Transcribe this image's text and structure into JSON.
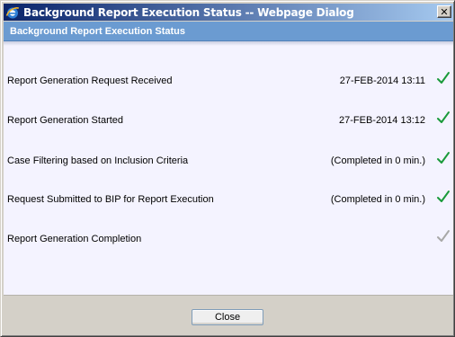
{
  "window": {
    "title": "Background Report Execution Status -- Webpage Dialog",
    "close_glyph": "✕"
  },
  "header": {
    "title": "Background Report Execution Status"
  },
  "steps": [
    {
      "label": "Report Generation Request Received",
      "value": "27-FEB-2014 13:11",
      "status": "complete",
      "icon": "green-check-icon"
    },
    {
      "label": "Report Generation Started",
      "value": "27-FEB-2014 13:12",
      "status": "complete",
      "icon": "green-check-icon"
    },
    {
      "label": "Case Filtering based on Inclusion Criteria",
      "value": "(Completed in 0 min.)",
      "status": "complete",
      "icon": "green-check-icon"
    },
    {
      "label": "Request Submitted to BIP for Report Execution",
      "value": "(Completed in 0 min.)",
      "status": "complete",
      "icon": "green-check-icon"
    },
    {
      "label": "Report Generation Completion",
      "value": "",
      "status": "pending",
      "icon": "grey-check-icon"
    }
  ],
  "footer": {
    "close_label": "Close"
  },
  "colors": {
    "complete": "#1a9a3a",
    "pending": "#a8a8a8",
    "header_band": "#6b9bd1",
    "content_bg": "#f4f3ff"
  }
}
